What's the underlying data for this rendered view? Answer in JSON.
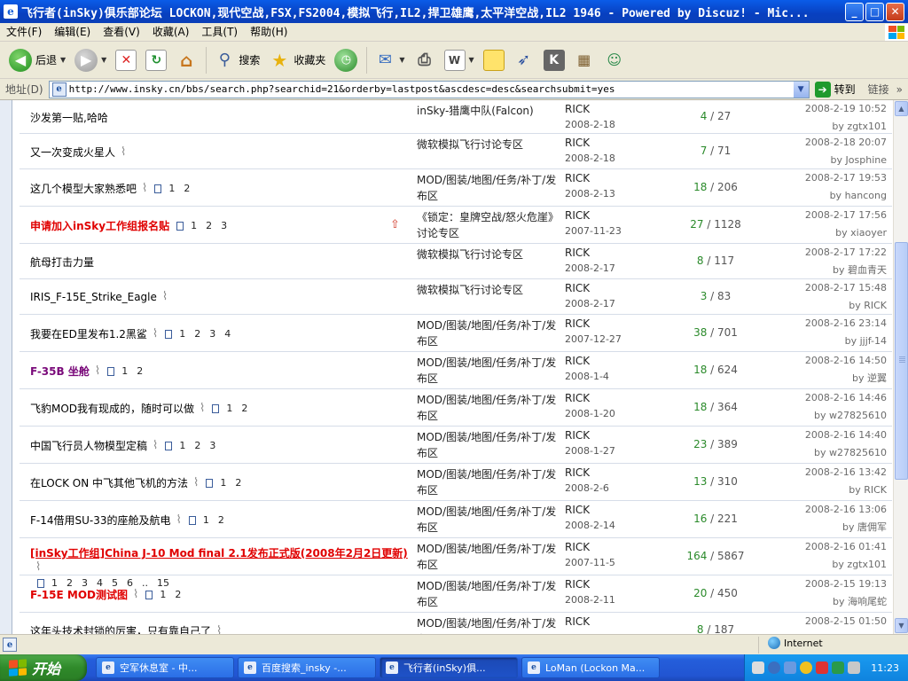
{
  "window": {
    "title": "飞行者(inSky)俱乐部论坛 LOCKON,现代空战,FSX,FS2004,模拟飞行,IL2,捍卫雄鹰,太平洋空战,IL2 1946 - Powered by Discuz! - Mic...",
    "app_icon": "e",
    "minimize": "_",
    "maximize": "□",
    "close": "✕"
  },
  "menu": [
    "文件(F)",
    "编辑(E)",
    "查看(V)",
    "收藏(A)",
    "工具(T)",
    "帮助(H)"
  ],
  "toolbar": {
    "back_label": "后退",
    "search_label": "搜索",
    "favorites_label": "收藏夹"
  },
  "address": {
    "label": "地址(D)",
    "url": "http://www.insky.cn/bbs/search.php?searchid=21&orderby=lastpost&ascdesc=desc&searchsubmit=yes",
    "go_label": "转到",
    "links_label": "链接"
  },
  "threads": [
    {
      "title": "沙发第一贴,哈哈",
      "style": "normal",
      "clip": false,
      "pages": [],
      "forum": "inSky-猎鹰中队(Falcon)",
      "author": "RICK",
      "date": "2008-2-18",
      "replies": "4",
      "views": "27",
      "last_time": "2008-2-19 10:52",
      "last_by": "zgtx101"
    },
    {
      "title": "又一次变成火星人",
      "style": "normal",
      "clip": true,
      "pages": [],
      "forum": "微软模拟飞行讨论专区",
      "author": "RICK",
      "date": "2008-2-18",
      "replies": "7",
      "views": "71",
      "last_time": "2008-2-18 20:07",
      "last_by": "Josphine"
    },
    {
      "title": "这几个模型大家熟悉吧",
      "style": "normal",
      "clip": true,
      "pages": [
        "1",
        "2"
      ],
      "forum": "MOD/图装/地图/任务/补丁/发布区",
      "author": "RICK",
      "date": "2008-2-13",
      "replies": "18",
      "views": "206",
      "last_time": "2008-2-17 19:53",
      "last_by": "hancong"
    },
    {
      "title": "申请加入inSky工作组报名贴",
      "style": "red",
      "clip": false,
      "hot": true,
      "pages": [
        "1",
        "2",
        "3"
      ],
      "forum": "《锁定：皇牌空战/怒火危崖》讨论专区",
      "author": "RICK",
      "date": "2007-11-23",
      "replies": "27",
      "views": "1128",
      "last_time": "2008-2-17 17:56",
      "last_by": "xiaoyer"
    },
    {
      "title": "航母打击力量",
      "style": "normal",
      "clip": false,
      "pages": [],
      "forum": "微软模拟飞行讨论专区",
      "author": "RICK",
      "date": "2008-2-17",
      "replies": "8",
      "views": "117",
      "last_time": "2008-2-17 17:22",
      "last_by": "碧血青天"
    },
    {
      "title": "IRIS_F-15E_Strike_Eagle",
      "style": "normal",
      "clip": true,
      "pages": [],
      "forum": "微软模拟飞行讨论专区",
      "author": "RICK",
      "date": "2008-2-17",
      "replies": "3",
      "views": "83",
      "last_time": "2008-2-17 15:48",
      "last_by": "RICK"
    },
    {
      "title": "我要在ED里发布1.2黑鲨",
      "style": "normal",
      "clip": true,
      "pages": [
        "1",
        "2",
        "3",
        "4"
      ],
      "forum": "MOD/图装/地图/任务/补丁/发布区",
      "author": "RICK",
      "date": "2007-12-27",
      "replies": "38",
      "views": "701",
      "last_time": "2008-2-16 23:14",
      "last_by": "jjjf-14"
    },
    {
      "title": "F-35B 坐舱",
      "style": "purple",
      "clip": true,
      "pages": [
        "1",
        "2"
      ],
      "forum": "MOD/图装/地图/任务/补丁/发布区",
      "author": "RICK",
      "date": "2008-1-4",
      "replies": "18",
      "views": "624",
      "last_time": "2008-2-16 14:50",
      "last_by": "逆翼"
    },
    {
      "title": "飞豹MOD我有现成的，随时可以做",
      "style": "normal",
      "clip": true,
      "pages": [
        "1",
        "2"
      ],
      "forum": "MOD/图装/地图/任务/补丁/发布区",
      "author": "RICK",
      "date": "2008-1-20",
      "replies": "18",
      "views": "364",
      "last_time": "2008-2-16 14:46",
      "last_by": "w27825610"
    },
    {
      "title": "中国飞行员人物模型定稿",
      "style": "normal",
      "clip": true,
      "pages": [
        "1",
        "2",
        "3"
      ],
      "forum": "MOD/图装/地图/任务/补丁/发布区",
      "author": "RICK",
      "date": "2008-1-27",
      "replies": "23",
      "views": "389",
      "last_time": "2008-2-16 14:40",
      "last_by": "w27825610"
    },
    {
      "title": "在LOCK ON 中飞其他飞机的方法",
      "style": "normal",
      "clip": true,
      "pages": [
        "1",
        "2"
      ],
      "forum": "MOD/图装/地图/任务/补丁/发布区",
      "author": "RICK",
      "date": "2008-2-6",
      "replies": "13",
      "views": "310",
      "last_time": "2008-2-16 13:42",
      "last_by": "RICK"
    },
    {
      "title": "F-14借用SU-33的座舱及航电",
      "style": "normal",
      "clip": true,
      "pages": [
        "1",
        "2"
      ],
      "forum": "MOD/图装/地图/任务/补丁/发布区",
      "author": "RICK",
      "date": "2008-2-14",
      "replies": "16",
      "views": "221",
      "last_time": "2008-2-16 13:06",
      "last_by": "唐佣军"
    },
    {
      "title": "[inSky工作组]China J-10 Mod final 2.1发布正式版(2008年2月2日更新)",
      "style": "red-underline",
      "clip": true,
      "pages": [
        "1",
        "2",
        "3",
        "4",
        "5",
        "6",
        "..",
        "15"
      ],
      "forum": "MOD/图装/地图/任务/补丁/发布区",
      "author": "RICK",
      "date": "2007-11-5",
      "replies": "164",
      "views": "5867",
      "last_time": "2008-2-16 01:41",
      "last_by": "zgtx101"
    },
    {
      "title": "F-15E MOD测试图",
      "style": "red",
      "clip": true,
      "pages": [
        "1",
        "2"
      ],
      "forum": "MOD/图装/地图/任务/补丁/发布区",
      "author": "RICK",
      "date": "2008-2-11",
      "replies": "20",
      "views": "450",
      "last_time": "2008-2-15 19:13",
      "last_by": "海响尾蛇"
    },
    {
      "title": "这年头技术封锁的厉害，只有靠自己了",
      "style": "normal",
      "clip": true,
      "pages": [],
      "forum": "MOD/图装/地图/任务/补丁/发布区",
      "author": "RICK",
      "date": "",
      "replies": "8",
      "views": "187",
      "last_time": "2008-2-15 01:50",
      "last_by": ""
    }
  ],
  "statusbar": {
    "zone": "Internet"
  },
  "taskbar": {
    "start": "开始",
    "tasks": [
      {
        "label": "空军休息室 - 中...",
        "active": false
      },
      {
        "label": "百度搜索_insky -...",
        "active": false
      },
      {
        "label": "飞行者(inSky)俱...",
        "active": true
      },
      {
        "label": "LoMan (Lockon Ma...",
        "active": false
      }
    ],
    "clock": "11:23"
  }
}
